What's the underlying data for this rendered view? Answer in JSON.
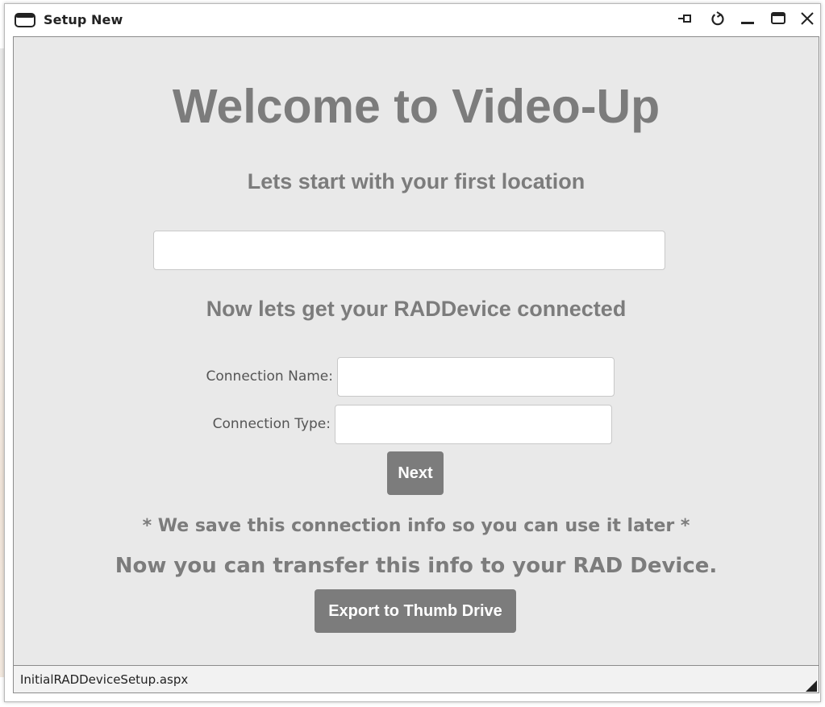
{
  "window": {
    "title": "Setup New",
    "controls": [
      "pin-icon",
      "refresh-icon",
      "minimize-icon",
      "maximize-icon",
      "close-icon"
    ]
  },
  "main": {
    "welcome_heading": "Welcome to Video-Up",
    "location_prompt": "Lets start with your first location",
    "location_value": "",
    "device_prompt": "Now lets get your RADDevice connected",
    "connection_name_label": "Connection Name:",
    "connection_name_value": "",
    "connection_type_label": "Connection Type:",
    "connection_type_value": "",
    "next_label": "Next",
    "save_note": "* We save this connection info so you can use it later *",
    "transfer_text": "Now you can transfer this info to your RAD Device.",
    "export_label": "Export to Thumb Drive"
  },
  "statusbar": {
    "page_name": "InitialRADDeviceSetup.aspx"
  },
  "colors": {
    "content_bg": "#e9e9e9",
    "heading_gray": "#7c7c7c",
    "button_bg": "#7c7c7c",
    "button_text": "#ffffff"
  }
}
